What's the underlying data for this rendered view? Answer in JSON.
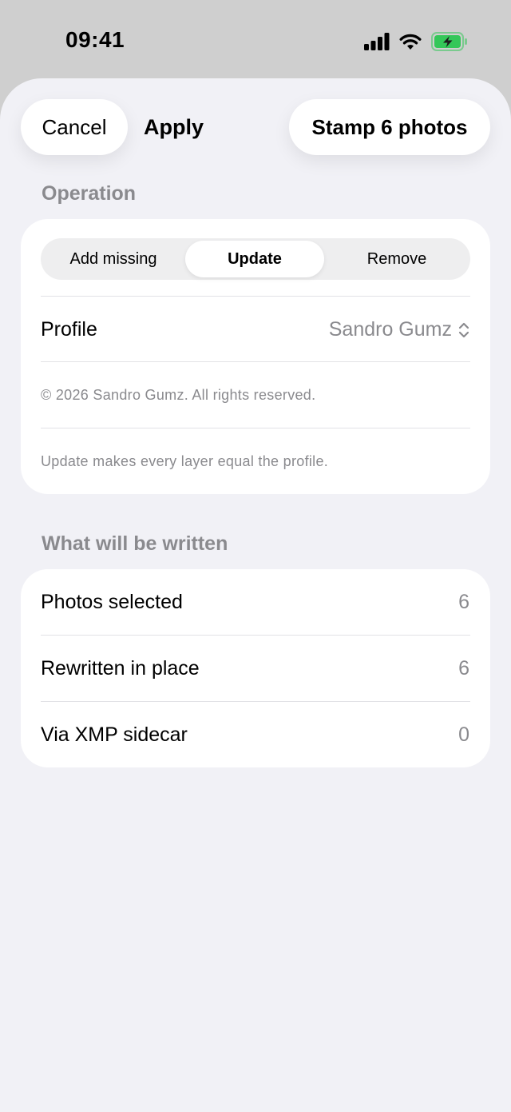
{
  "status_bar": {
    "time": "09:41",
    "icons": [
      "cellular-signal-icon",
      "wifi-icon",
      "battery-charging-icon"
    ],
    "battery_color": "#34c759"
  },
  "toolbar": {
    "cancel_label": "Cancel",
    "title": "Apply",
    "stamp_label": "Stamp 6 photos"
  },
  "operation": {
    "header": "Operation",
    "segments": [
      "Add missing",
      "Update",
      "Remove"
    ],
    "selected": "Update",
    "profile_label": "Profile",
    "profile_value": "Sandro Gumz",
    "copyright": "© 2026 Sandro Gumz. All rights reserved.",
    "description": "Update makes every layer equal the profile."
  },
  "summary": {
    "header": "What will be written",
    "rows": [
      {
        "label": "Photos selected",
        "value": "6"
      },
      {
        "label": "Rewritten in place",
        "value": "6"
      },
      {
        "label": "Via XMP sidecar",
        "value": "0"
      }
    ]
  },
  "colors": {
    "sheet_background": "#f1f1f6",
    "secondary_text": "#8a8a8e"
  }
}
